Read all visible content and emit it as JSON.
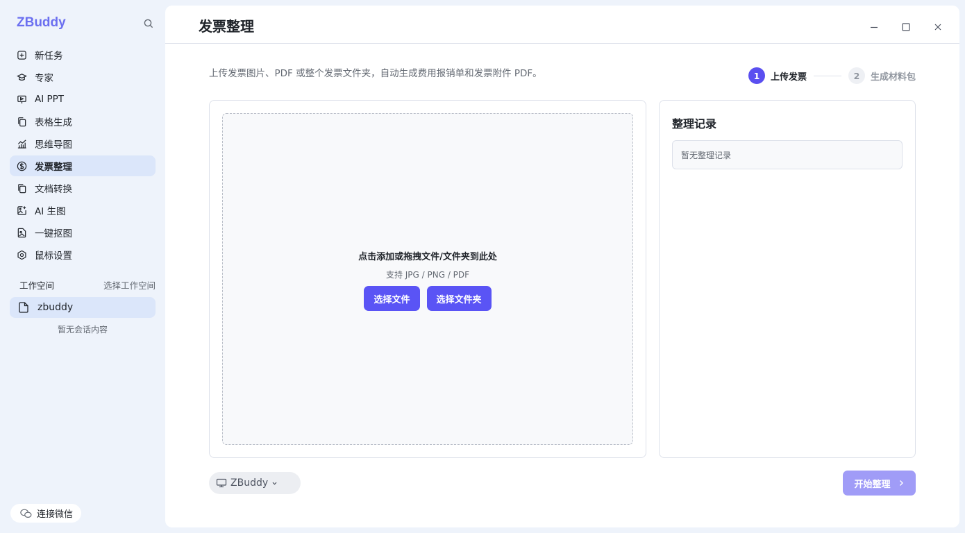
{
  "app": {
    "brand": "ZBuddy"
  },
  "colors": {
    "accent": "#5a54f5",
    "accent_disabled": "#a09cf7",
    "active_nav_bg": "#dbe6fa"
  },
  "sidebar": {
    "items": [
      {
        "label": "新任务",
        "icon": "plus-square-icon"
      },
      {
        "label": "专家",
        "icon": "graduation-cap-icon"
      },
      {
        "label": "AI PPT",
        "icon": "presentation-icon"
      },
      {
        "label": "表格生成",
        "icon": "copy-document-icon"
      },
      {
        "label": "思维导图",
        "icon": "chart-line-icon"
      },
      {
        "label": "发票整理",
        "icon": "dollar-circle-icon",
        "active": true
      },
      {
        "label": "文档转换",
        "icon": "copy-document-icon"
      },
      {
        "label": "AI 生图",
        "icon": "image-sparkle-icon"
      },
      {
        "label": "一键抠图",
        "icon": "file-image-icon"
      },
      {
        "label": "鼠标设置",
        "icon": "hexagon-settings-icon"
      }
    ],
    "workspace": {
      "title": "工作空间",
      "select_label": "选择工作空间",
      "current": "zbuddy",
      "empty_text": "暂无会话内容"
    },
    "wechat_label": "连接微信"
  },
  "main": {
    "title": "发票整理",
    "description": "上传发票图片、PDF 或整个发票文件夹，自动生成费用报销单和发票附件 PDF。",
    "steps": [
      {
        "num": "1",
        "label": "上传发票",
        "active": true
      },
      {
        "num": "2",
        "label": "生成材料包",
        "active": false
      }
    ],
    "upload": {
      "title": "点击添加或拖拽文件/文件夹到此处",
      "subtitle": "支持 JPG / PNG / PDF",
      "select_file": "选择文件",
      "select_folder": "选择文件夹"
    },
    "records": {
      "title": "整理记录",
      "empty_text": "暂无整理记录"
    },
    "device": {
      "label": "ZBuddy"
    },
    "start_label": "开始整理"
  }
}
